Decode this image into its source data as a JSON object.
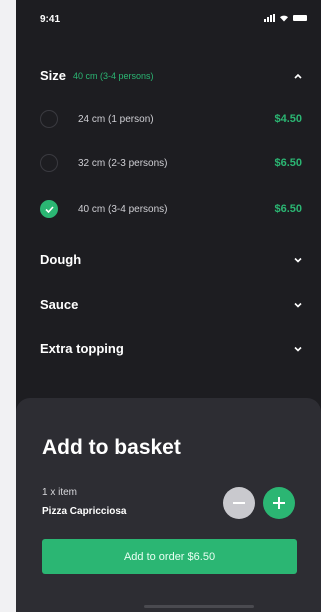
{
  "status_bar": {
    "time": "9:41"
  },
  "sections": {
    "size": {
      "title": "Size",
      "selected": "40 cm (3-4 persons)",
      "chevron": "up-chevron-icon"
    },
    "dough": {
      "title": "Dough",
      "chevron": "down-chevron-icon"
    },
    "sauce": {
      "title": "Sauce",
      "chevron": "down-chevron-icon"
    },
    "extra": {
      "title": "Extra topping",
      "chevron": "down-chevron-icon"
    }
  },
  "size_options": [
    {
      "label": "24 cm (1 person)",
      "price": "$4.50",
      "checked": false
    },
    {
      "label": "32 cm (2-3 persons)",
      "price": "$6.50",
      "checked": false
    },
    {
      "label": "40 cm (3-4 persons)",
      "price": "$6.50",
      "checked": true
    }
  ],
  "basket": {
    "title": "Add to basket",
    "quantity": "1 x item",
    "item_name": "Pizza Capricciosa",
    "button_label": "Add to order $6.50"
  },
  "colors": {
    "accent": "#2bb673",
    "background": "#1d1d21",
    "sheet": "#2d2d33"
  }
}
